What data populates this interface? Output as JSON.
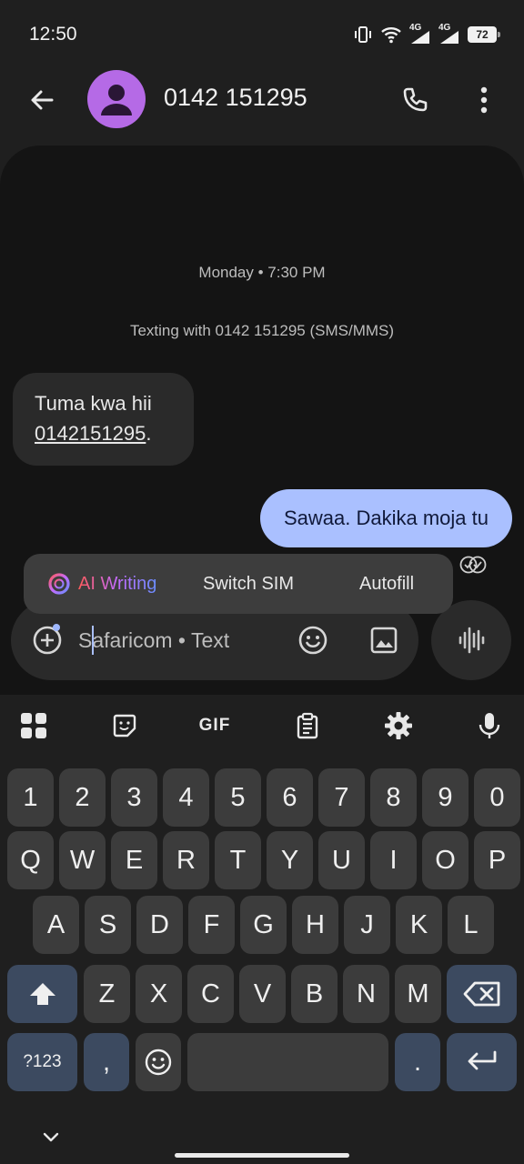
{
  "status_bar": {
    "time": "12:50",
    "network_1": "4G",
    "network_2": "4G",
    "battery": "72",
    "icons": [
      "vibrate-icon",
      "wifi-icon",
      "signal-4g-icon",
      "signal-4g-icon",
      "battery-icon"
    ]
  },
  "header": {
    "title": "0142 151295",
    "icons": [
      "back-arrow-icon",
      "person-avatar-icon",
      "phone-icon",
      "more-vert-icon"
    ]
  },
  "conversation": {
    "date_separator": "Monday • 7:30 PM",
    "texting_info": "Texting with 0142 151295 (SMS/MMS)",
    "incoming": {
      "line1": "Tuma kwa hii",
      "link": "0142151295",
      "suffix": "."
    },
    "outgoing": {
      "text": "Sawaa. Dakika moja tu",
      "status_icon": "delivered-check-icon"
    }
  },
  "suggestions": {
    "ai_writing": "AI Writing",
    "switch_sim": "Switch SIM",
    "autofill": "Autofill"
  },
  "compose": {
    "placeholder": "Safaricom • Text",
    "icons": [
      "add-circle-icon",
      "emoji-icon",
      "image-icon",
      "voice-waveform-icon"
    ]
  },
  "keyboard": {
    "toolbar": [
      "apps-grid-icon",
      "sticker-icon",
      "gif-icon",
      "clipboard-icon",
      "settings-gear-icon",
      "microphone-icon"
    ],
    "gif_label": "GIF",
    "row_numbers": [
      "1",
      "2",
      "3",
      "4",
      "5",
      "6",
      "7",
      "8",
      "9",
      "0"
    ],
    "row_top": [
      "Q",
      "W",
      "E",
      "R",
      "T",
      "Y",
      "U",
      "I",
      "O",
      "P"
    ],
    "row_home": [
      "A",
      "S",
      "D",
      "F",
      "G",
      "H",
      "J",
      "K",
      "L"
    ],
    "row_bottom": [
      "Z",
      "X",
      "C",
      "V",
      "B",
      "N",
      "M"
    ],
    "symbols_key": "?123",
    "comma_key": ",",
    "period_key": ".",
    "special_icons": [
      "shift-icon",
      "backspace-icon",
      "emoji-key-icon",
      "enter-icon",
      "keyboard-collapse-icon"
    ]
  },
  "colors": {
    "background": "#1f1f1f",
    "conversation_bg": "#141414",
    "outgoing_bubble": "#aac0ff",
    "incoming_bubble": "#2a2a2a",
    "avatar": "#b56ae6",
    "special_key": "#3c4a60",
    "key": "#3c3c3c"
  }
}
